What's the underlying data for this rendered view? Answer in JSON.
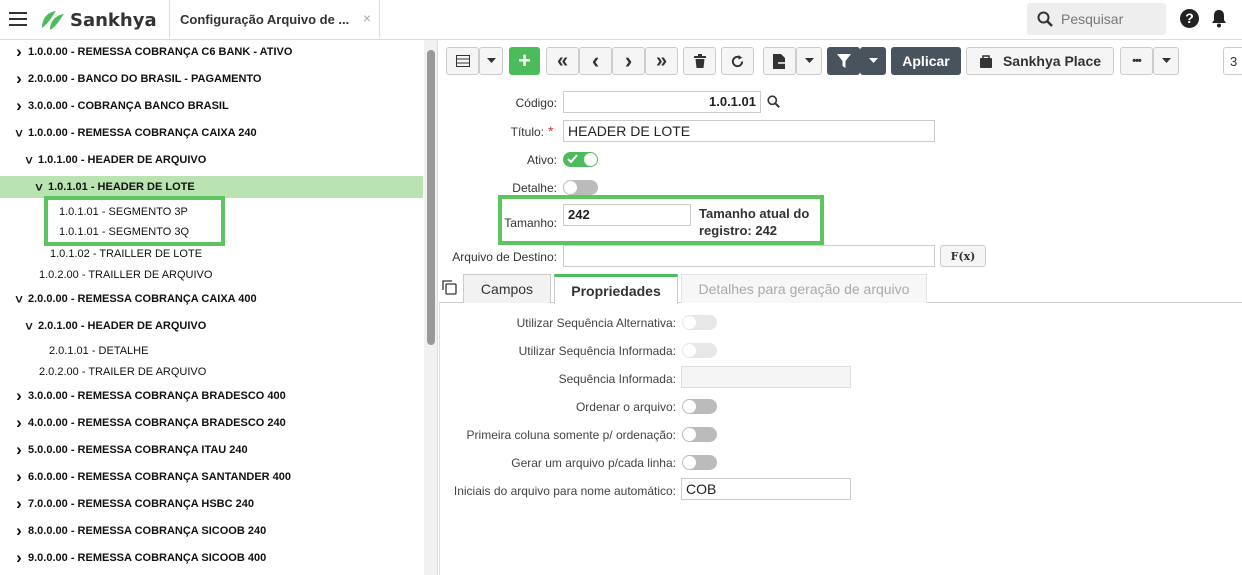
{
  "header": {
    "logo_text": "Sankhya",
    "tab_title": "Configuração Arquivo de ...",
    "tab_close": "×",
    "search_placeholder": "Pesquisar",
    "help_glyph": "?"
  },
  "tree": {
    "items": [
      {
        "label": "1.0.0.00 - REMESSA COBRANÇA C6 BANK - ATIVO",
        "chev": "›",
        "bold": true
      },
      {
        "label": "2.0.0.00 - BANCO DO BRASIL - PAGAMENTO",
        "chev": "›",
        "bold": true
      },
      {
        "label": "3.0.0.00 - COBRANÇA BANCO BRASIL",
        "chev": "›",
        "bold": true
      },
      {
        "label": "1.0.0.00 - REMESSA COBRANÇA CAIXA 240",
        "chev": "˅",
        "bold": true
      },
      {
        "label": "1.0.1.00 - HEADER DE ARQUIVO",
        "chev": "˅",
        "bold": true
      },
      {
        "label": "1.0.1.01 - HEADER DE LOTE",
        "chev": "˅",
        "bold": true,
        "selected": true
      },
      {
        "label": "1.0.1.01 - SEGMENTO 3P",
        "bold": false
      },
      {
        "label": "1.0.1.01 - SEGMENTO 3Q",
        "bold": false
      },
      {
        "label": "1.0.1.02 - TRAILLER DE LOTE",
        "bold": false
      },
      {
        "label": "1.0.2.00 - TRAILLER DE ARQUIVO",
        "bold": false
      },
      {
        "label": "2.0.0.00 - REMESSA COBRANÇA CAIXA 400",
        "chev": "˅",
        "bold": true
      },
      {
        "label": "2.0.1.00 - HEADER DE ARQUIVO",
        "chev": "˅",
        "bold": true
      },
      {
        "label": "2.0.1.01 - DETALHE",
        "bold": false
      },
      {
        "label": "2.0.2.00 - TRAILER DE ARQUIVO",
        "bold": false
      },
      {
        "label": "3.0.0.00 - REMESSA COBRANÇA BRADESCO 400",
        "chev": "›",
        "bold": true
      },
      {
        "label": "4.0.0.00 - REMESSA COBRANÇA BRADESCO 240",
        "chev": "›",
        "bold": true
      },
      {
        "label": "5.0.0.00 - REMESSA COBRANÇA ITAU 240",
        "chev": "›",
        "bold": true
      },
      {
        "label": "6.0.0.00 - REMESSA COBRANÇA SANTANDER 400",
        "chev": "›",
        "bold": true
      },
      {
        "label": "7.0.0.00 - REMESSA COBRANÇA HSBC 240",
        "chev": "›",
        "bold": true
      },
      {
        "label": "8.0.0.00 - REMESSA COBRANÇA SICOOB 240",
        "chev": "›",
        "bold": true
      },
      {
        "label": "9.0.0.00 - REMESSA COBRANÇA SICOOB 400",
        "chev": "›",
        "bold": true
      }
    ]
  },
  "toolbar": {
    "add": "+",
    "first": "«",
    "prev": "‹",
    "next": "›",
    "last": "»",
    "apply_label": "Aplicar",
    "place_label": "Sankhya Place",
    "more": "•••",
    "page_partial": "3"
  },
  "form": {
    "codigo_label": "Código:",
    "codigo_value": "1.0.1.01",
    "titulo_label": "Título:",
    "titulo_required": "*",
    "titulo_value": "HEADER DE LOTE",
    "ativo_label": "Ativo:",
    "detalhe_label": "Detalhe:",
    "tamanho_label": "Tamanho:",
    "tamanho_value": "242",
    "tamanho_note": "Tamanho atual do registro: 242",
    "destino_label": "Arquivo de Destino:",
    "destino_value": "",
    "fx_label": "F(x)"
  },
  "tabs": [
    {
      "label": "Campos"
    },
    {
      "label": "Propriedades"
    },
    {
      "label": "Detalhes para geração de arquivo"
    }
  ],
  "properties": {
    "seq_alt_label": "Utilizar Sequência Alternativa:",
    "seq_inf_label": "Utilizar Sequência Informada:",
    "seq_val_label": "Sequência Informada:",
    "seq_val_value": "",
    "ordenar_label": "Ordenar o arquivo:",
    "primeira_label": "Primeira coluna somente p/ ordenação:",
    "gerar_label": "Gerar um arquivo p/cada linha:",
    "iniciais_label": "Iniciais do arquivo para nome automático:",
    "iniciais_value": "COB"
  },
  "colors": {
    "accent_green": "#4cbb5b",
    "selected_row": "#b9e4b2",
    "highlight_box": "#5dc45f",
    "dark_button": "#49535e"
  }
}
